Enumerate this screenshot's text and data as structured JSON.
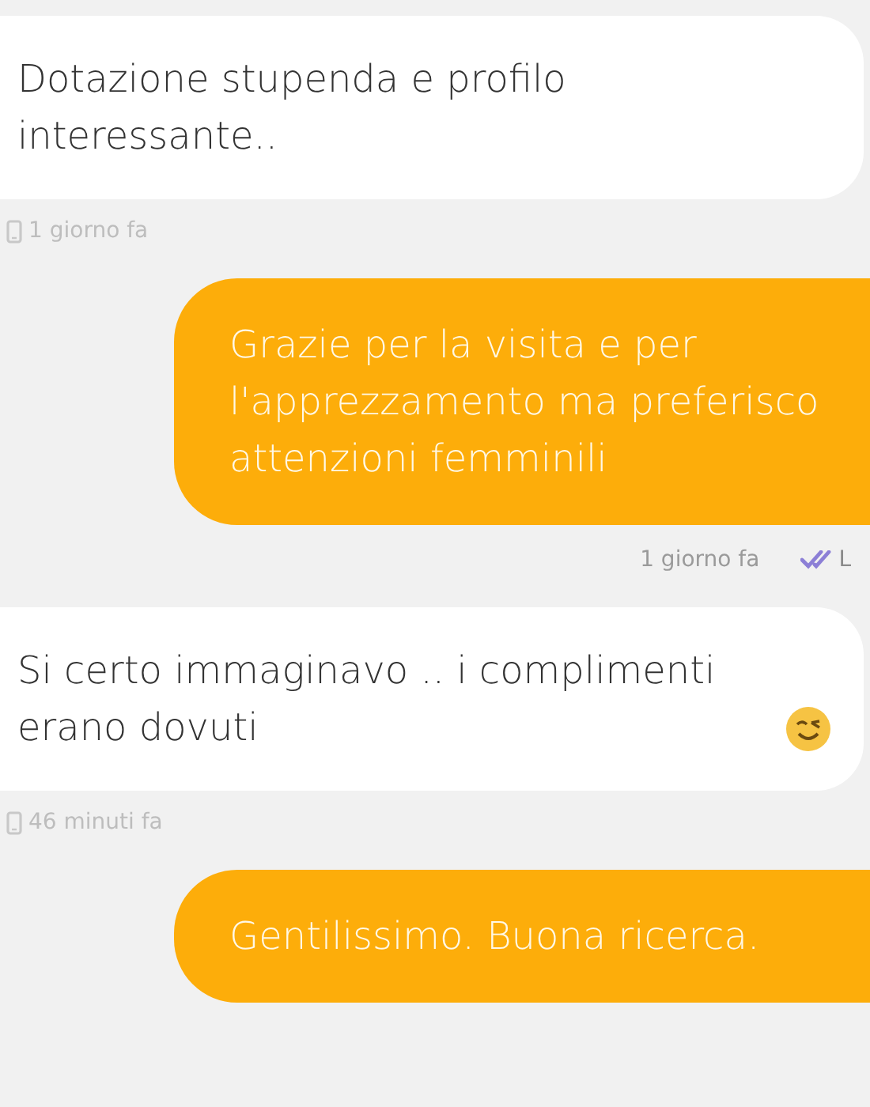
{
  "messages": [
    {
      "kind": "incoming",
      "text": "Dotazione stupenda e profilo interessante..",
      "time": "1 giorno fa"
    },
    {
      "kind": "outgoing",
      "text": "Grazie per la visita e per l'apprezzamento ma preferisco attenzioni femminili",
      "time": "1 giorno fa",
      "read": true,
      "status": "L"
    },
    {
      "kind": "incoming",
      "text": "Si certo immaginavo .. i complimenti erano dovuti",
      "emoji": true,
      "time": "46 minuti fa"
    },
    {
      "kind": "outgoing",
      "text": "Gentilissimo. Buona ricerca."
    }
  ]
}
